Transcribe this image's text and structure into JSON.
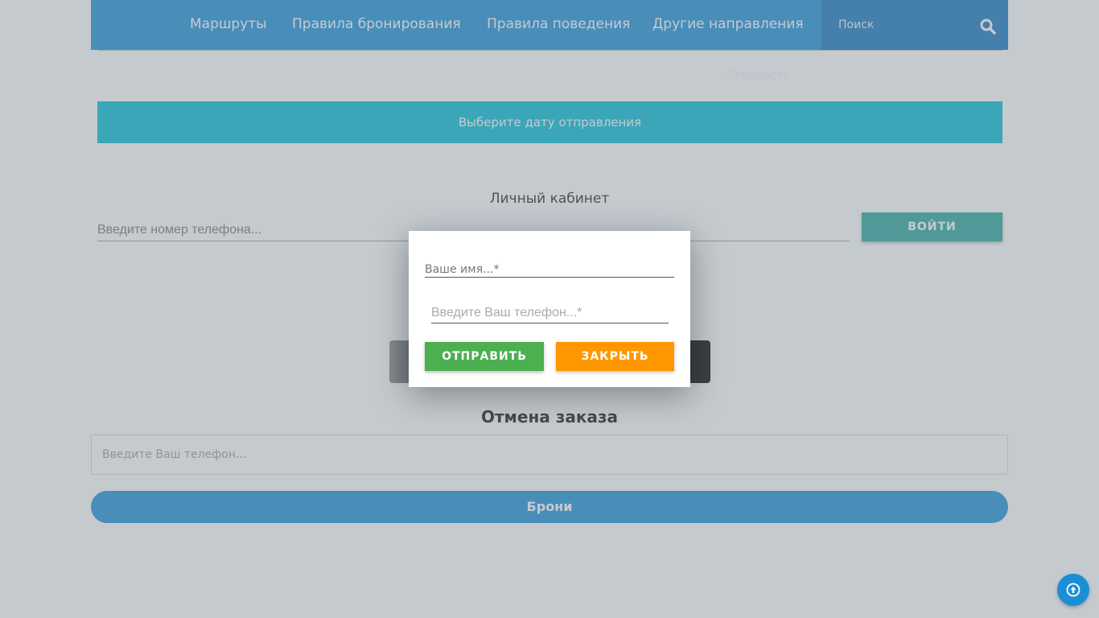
{
  "nav": {
    "links": [
      "Маршруты",
      "Правила бронирования",
      "Правила поведения",
      "Другие направления"
    ],
    "search_placeholder": "Поиск",
    "icon": "search-icon"
  },
  "faint_link": "Стоимость",
  "date_bar": {
    "label": "Выберите дату отправления"
  },
  "cabinet": {
    "title": "Личный кабинет",
    "phone_placeholder": "Введите номер телефона...",
    "login_label": "ВОЙТИ"
  },
  "cancel": {
    "title": "Отмена заказа",
    "phone_placeholder": "Введите Ваш телефон...",
    "bookings_label": "Брони"
  },
  "modal": {
    "name_placeholder": "Ваше имя...*",
    "phone_placeholder": "Введите Ваш телефон...*",
    "send_label": "ОТПРАВИТЬ",
    "close_label": "ЗАКРЫТЬ"
  },
  "fab": {
    "icon": "arrow-up-circle-icon"
  },
  "colors": {
    "nav": "#1a8fd6",
    "date_bar": "#00bcd4",
    "login": "#26a69a",
    "send": "#4caf50",
    "close": "#ff9800"
  }
}
